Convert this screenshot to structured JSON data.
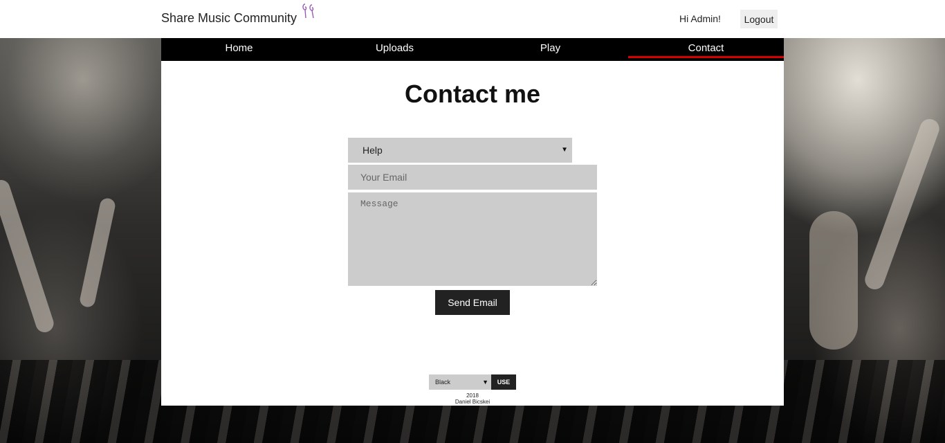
{
  "header": {
    "brand": "Share Music Community",
    "brand_icon": "earphones-icon",
    "greeting": "Hi Admin!",
    "logout_label": "Logout"
  },
  "nav": {
    "items": [
      {
        "label": "Home"
      },
      {
        "label": "Uploads"
      },
      {
        "label": "Play"
      },
      {
        "label": "Contact"
      }
    ],
    "active": "Contact",
    "active_color": "#d60000"
  },
  "contact": {
    "title": "Contact me",
    "subject_selected": "Help",
    "email_placeholder": "Your Email",
    "message_placeholder": "Message",
    "send_label": "Send Email"
  },
  "theme": {
    "selected": "Black",
    "use_label": "USE"
  },
  "footer": {
    "year": "2018",
    "author": "Daniel Bicskei"
  }
}
